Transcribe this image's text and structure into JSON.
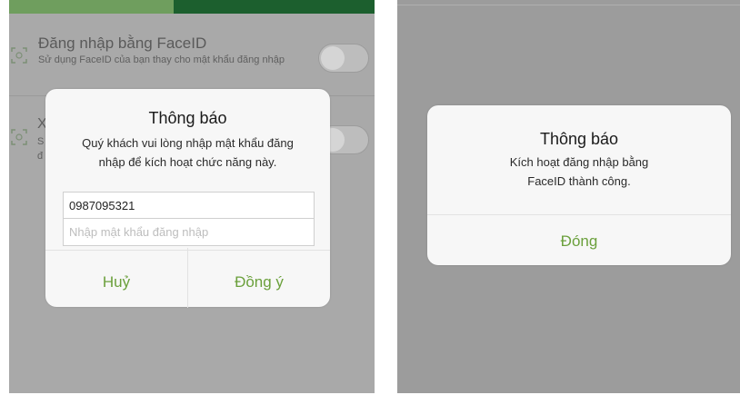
{
  "left_screen": {
    "background_setting": {
      "title": "Đăng nhập bằng FaceID",
      "description": "Sử dụng FaceID của bạn thay cho mật khẩu đăng nhập",
      "partial_fragments": [
        "X",
        "S",
        "đ"
      ]
    },
    "dialog": {
      "title": "Thông báo",
      "message": "Quý khách vui lòng nhập mật khẩu đăng nhập để kích hoạt chức năng này.",
      "phone_value": "0987095321",
      "password_placeholder": "Nhập mật khẩu đăng nhập",
      "cancel_label": "Huỷ",
      "confirm_label": "Đồng ý"
    }
  },
  "right_screen": {
    "dialog": {
      "title": "Thông báo",
      "message": "Kích hoạt đăng nhập bằng FaceID thành công.",
      "close_label": "Đóng"
    }
  },
  "colors": {
    "accent_green": "#6ba03c",
    "header_green": "#1c5f2e",
    "overlay_gray": "#a9a9a9"
  },
  "icons": [
    "faceid-icon"
  ]
}
